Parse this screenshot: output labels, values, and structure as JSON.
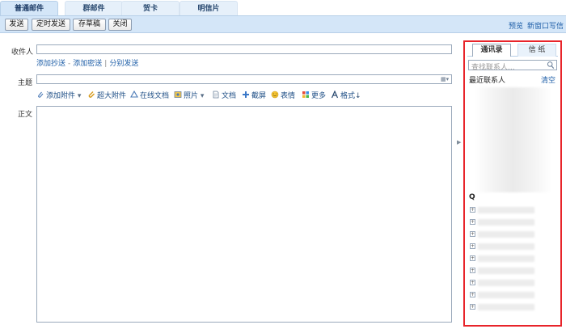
{
  "tabs": [
    {
      "label": "普通邮件"
    },
    {
      "label": "群邮件"
    },
    {
      "label": "贺卡"
    },
    {
      "label": "明信片"
    }
  ],
  "toolbar": {
    "send": "发送",
    "timed_send": "定时发送",
    "save_draft": "存草稿",
    "close": "关闭",
    "preview": "预览",
    "new_window": "新窗口写信"
  },
  "form": {
    "to_label": "收件人",
    "to_value": "",
    "add_cc": "添加抄送",
    "add_bcc": "添加密送",
    "separate_send": "分别发送",
    "subject_label": "主题",
    "subject_value": "",
    "body_label": "正文",
    "body_value": ""
  },
  "format_bar": [
    {
      "label": "添加附件",
      "icon": "paperclip-icon"
    },
    {
      "label": "超大附件",
      "icon": "large-attachment-icon"
    },
    {
      "label": "在线文档",
      "icon": "online-doc-icon"
    },
    {
      "label": "照片",
      "icon": "photo-icon"
    },
    {
      "label": "文档",
      "icon": "document-icon"
    },
    {
      "label": "截屏",
      "icon": "screenshot-icon"
    },
    {
      "label": "表情",
      "icon": "emoji-icon"
    },
    {
      "label": "更多",
      "icon": "more-icon"
    },
    {
      "label": "格式",
      "icon": "format-icon"
    }
  ],
  "panel": {
    "tab_contacts": "通讯录",
    "tab_stationery": "信 纸",
    "search_placeholder": "查找联系人...",
    "recent_label": "最近联系人",
    "clear_label": "清空",
    "group_initial": "Q"
  },
  "colors": {
    "accent": "#1f5fa8",
    "panel_border": "#e8242a",
    "toolbar_bg": "#d4e6f8"
  }
}
